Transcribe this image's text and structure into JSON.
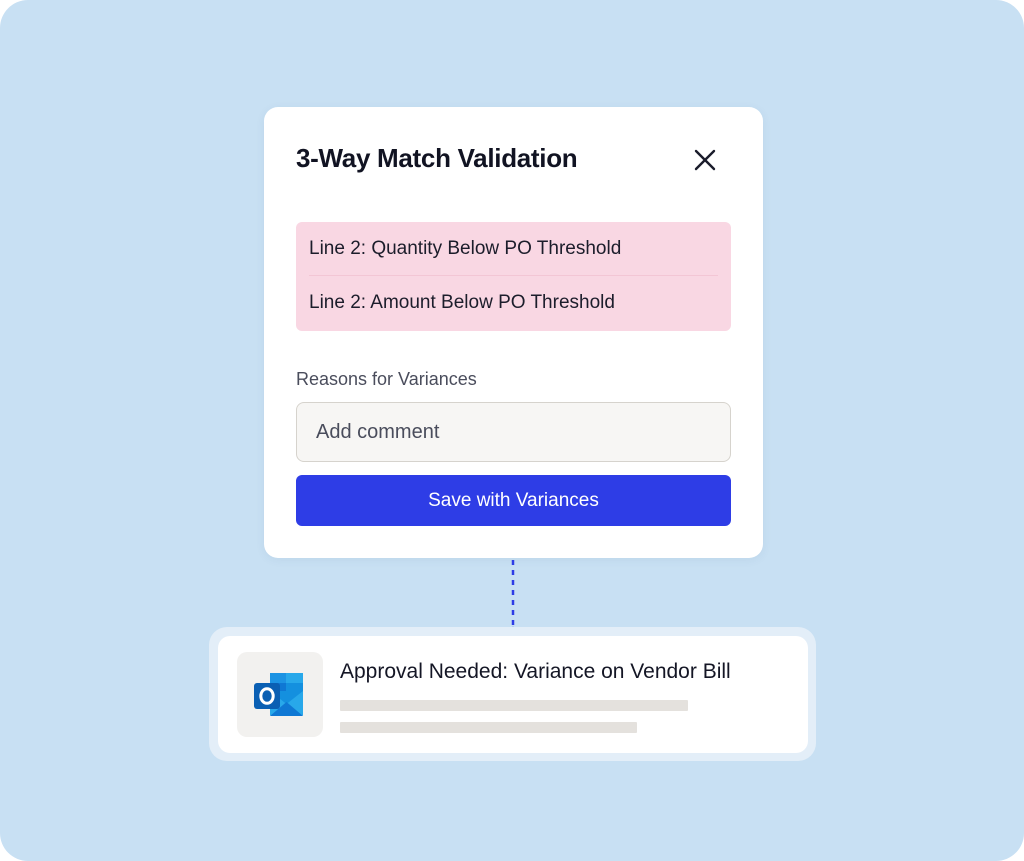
{
  "dialog": {
    "title": "3-Way Match Validation",
    "close_icon": "close-icon",
    "validation_errors": [
      "Line 2: Quantity Below PO Threshold",
      "Line 2: Amount Below PO Threshold"
    ],
    "reasons_label": "Reasons for Variances",
    "comment_placeholder": "Add comment",
    "comment_value": "",
    "save_button_label": "Save with Variances"
  },
  "notification": {
    "app_icon": "outlook-icon",
    "title": "Approval Needed: Variance on Vendor Bill"
  },
  "colors": {
    "background": "#c8e0f3",
    "error_background": "#f9d7e3",
    "primary_button": "#2e3de6",
    "connector": "#2e3de6",
    "skeleton": "#e4e1dd"
  }
}
